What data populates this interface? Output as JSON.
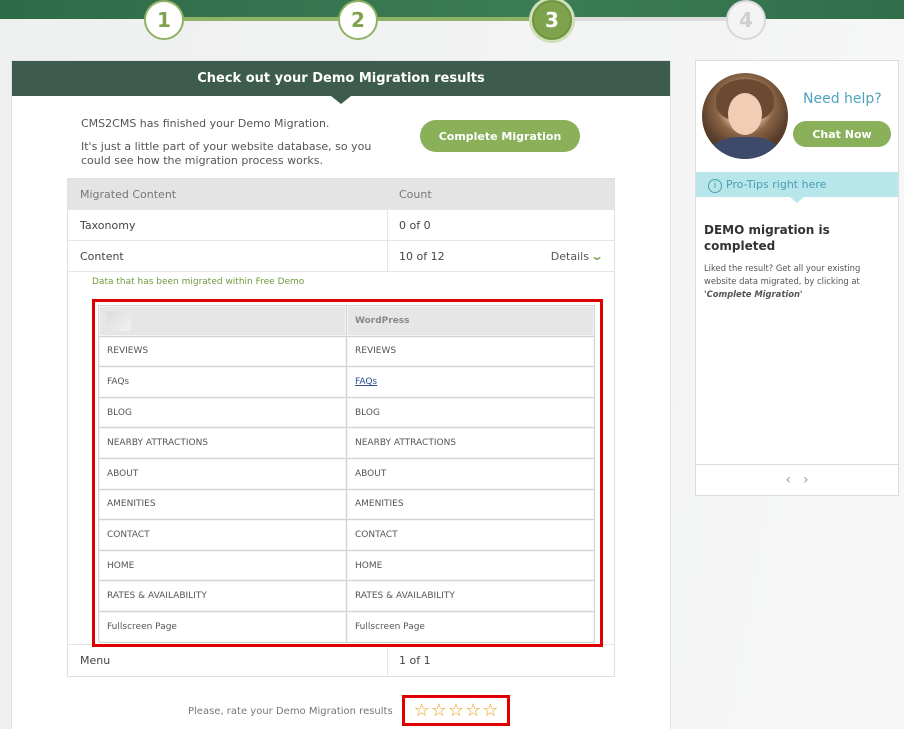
{
  "steps": [
    "1",
    "2",
    "3",
    "4"
  ],
  "progress": {
    "current_step": 3,
    "total_steps": 4
  },
  "main": {
    "header": "Check out your Demo Migration results",
    "finished_line1": "CMS2CMS has finished your Demo Migration.",
    "finished_line2": "It's just a little part of your website database, so you could see how the migration process works.",
    "complete_button": "Complete Migration",
    "results": {
      "headers": [
        "Migrated Content",
        "Count"
      ],
      "taxonomy": {
        "label": "Taxonomy",
        "count": "0 of 0"
      },
      "content": {
        "label": "Content",
        "count": "10 of 12",
        "details": "Details"
      },
      "menu": {
        "label": "Menu",
        "count": "1 of 1"
      }
    },
    "migrated_note": "Data that has been migrated within Free Demo",
    "inner_table": {
      "target_header": "WordPress",
      "rows": [
        [
          "REVIEWS",
          "REVIEWS"
        ],
        [
          "FAQs",
          "FAQs"
        ],
        [
          "BLOG",
          "BLOG"
        ],
        [
          "NEARBY ATTRACTIONS",
          "NEARBY ATTRACTIONS"
        ],
        [
          "ABOUT",
          "ABOUT"
        ],
        [
          "AMENITIES",
          "AMENITIES"
        ],
        [
          "CONTACT",
          "CONTACT"
        ],
        [
          "HOME",
          "HOME"
        ],
        [
          "RATES & AVAILABILITY",
          "RATES & AVAILABILITY"
        ],
        [
          "Fullscreen Page",
          "Fullscreen Page"
        ]
      ]
    },
    "rate_text": "Please, rate your Demo Migration results",
    "rating": {
      "value": 0,
      "max": 5
    }
  },
  "side": {
    "need_help": "Need help?",
    "chat_button": "Chat Now",
    "protips": "Pro-Tips right here",
    "tip_title": "DEMO migration is completed",
    "tip_body_prefix": "Liked the result? Get all your existing website data migrated, by clicking at ",
    "tip_body_bold": "'Complete Migration'"
  },
  "colors": {
    "accent_green": "#8ab05a",
    "header_green": "#3d5c4d",
    "highlight_red": "#e00000",
    "help_blue": "#4fa3c0"
  },
  "icons": [
    "chevron-down-icon",
    "star-icon",
    "info-icon",
    "arrow-left-icon",
    "arrow-right-icon"
  ]
}
